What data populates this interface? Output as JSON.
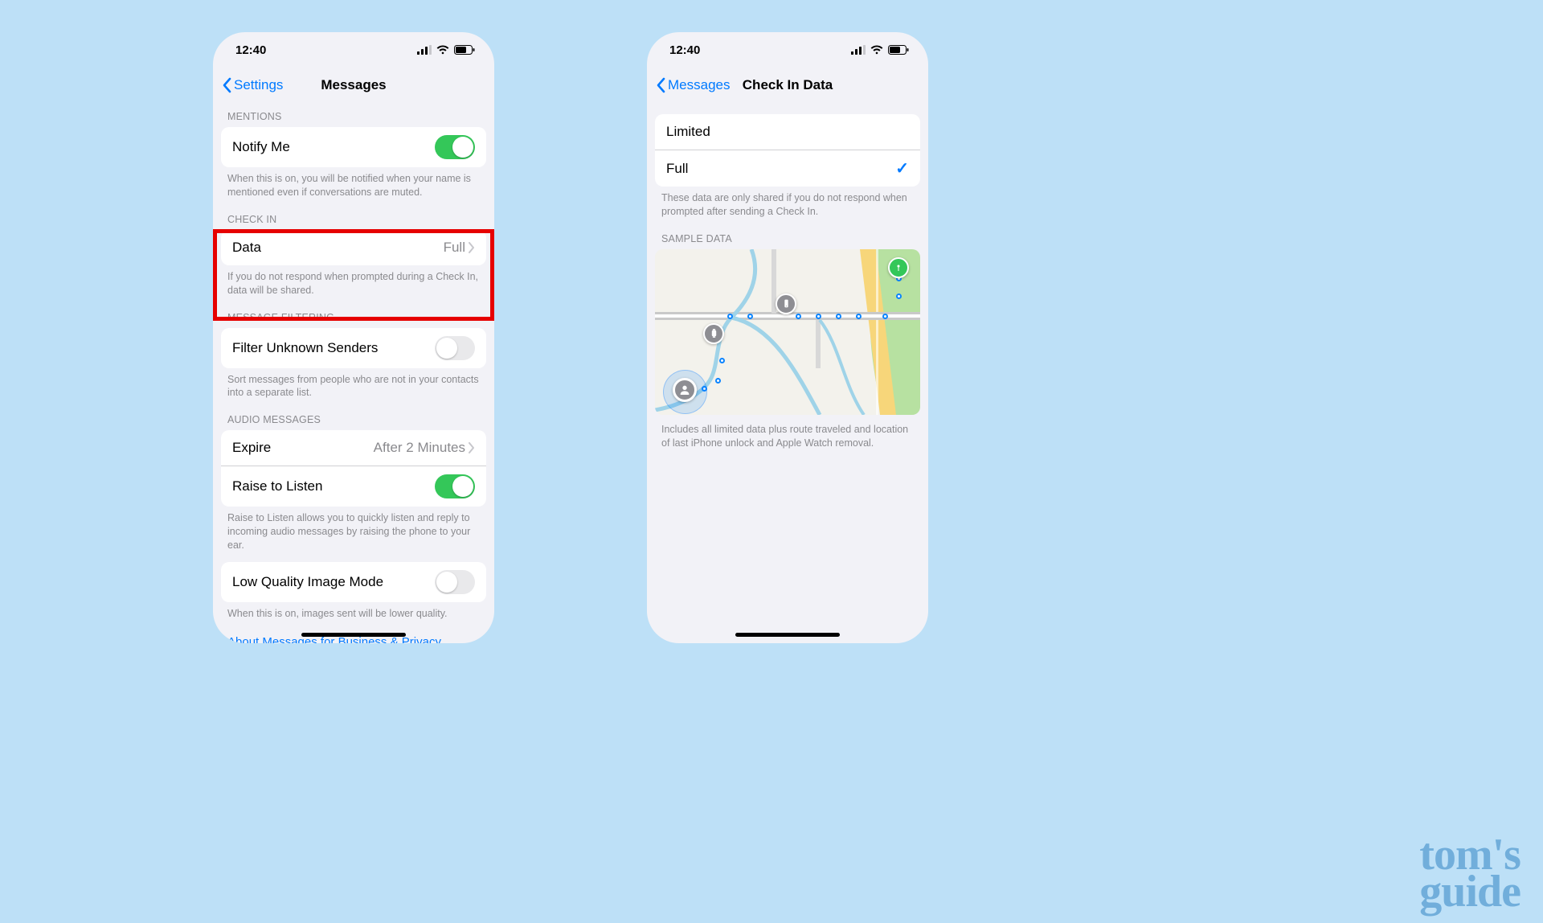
{
  "status": {
    "time": "12:40"
  },
  "left": {
    "back": "Settings",
    "title": "Messages",
    "mentions": {
      "header": "MENTIONS",
      "label": "Notify Me",
      "footer": "When this is on, you will be notified when your name is mentioned even if conversations are muted."
    },
    "checkin": {
      "header": "CHECK IN",
      "label": "Data",
      "value": "Full",
      "footer": "If you do not respond when prompted during a Check In, data will be shared."
    },
    "filtering": {
      "header": "MESSAGE FILTERING",
      "label": "Filter Unknown Senders",
      "footer": "Sort messages from people who are not in your contacts into a separate list."
    },
    "audio": {
      "header": "AUDIO MESSAGES",
      "expire_label": "Expire",
      "expire_value": "After 2 Minutes",
      "raise_label": "Raise to Listen",
      "footer": "Raise to Listen allows you to quickly listen and reply to incoming audio messages by raising the phone to your ear."
    },
    "lowquality": {
      "label": "Low Quality Image Mode",
      "footer": "When this is on, images sent will be lower quality."
    },
    "about_link": "About Messages for Business & Privacy"
  },
  "right": {
    "back": "Messages",
    "title": "Check In Data",
    "options": {
      "limited": "Limited",
      "full": "Full"
    },
    "options_footer": "These data are only shared if you do not respond when prompted after sending a Check In.",
    "sample_header": "SAMPLE DATA",
    "sample_footer": "Includes all limited data plus route traveled and location of last iPhone unlock and Apple Watch removal."
  },
  "watermark": {
    "line1": "tom's",
    "line2": "guide"
  }
}
